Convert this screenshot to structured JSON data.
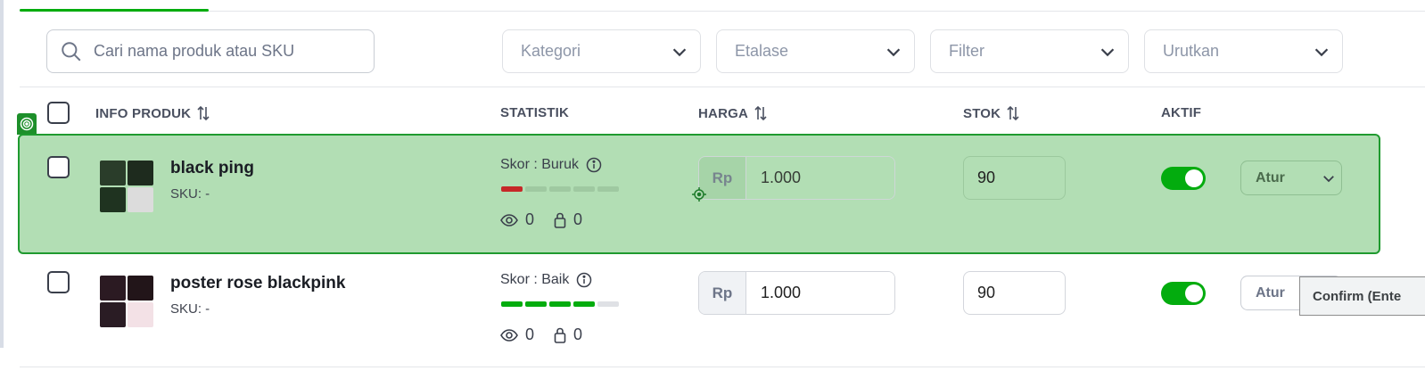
{
  "search": {
    "placeholder": "Cari nama produk atau SKU"
  },
  "filters": [
    {
      "label": "Kategori"
    },
    {
      "label": "Etalase"
    },
    {
      "label": "Filter"
    },
    {
      "label": "Urutkan"
    }
  ],
  "table": {
    "headers": {
      "info": "INFO PRODUK",
      "statistik": "STATISTIK",
      "harga": "HARGA",
      "stok": "STOK",
      "aktif": "AKTIF"
    },
    "rows": [
      {
        "name": "black ping",
        "sku": "SKU: -",
        "skor_label": "Skor : Buruk",
        "score_level": 1,
        "score_color": "#c62828",
        "views": "0",
        "sold": "0",
        "currency": "Rp",
        "price": "1.000",
        "stock": "90",
        "active": true,
        "action": "Atur"
      },
      {
        "name": "poster rose blackpink",
        "sku": "SKU: -",
        "skor_label": "Skor : Baik",
        "score_level": 4,
        "score_color": "#03ac0e",
        "views": "0",
        "sold": "0",
        "currency": "Rp",
        "price": "1.000",
        "stock": "90",
        "active": true,
        "action": "Atur"
      }
    ]
  },
  "tooltip": {
    "text": "Confirm (Ente"
  },
  "colors": {
    "accent": "#03ac0e",
    "highlight": "#b2deb4",
    "highlight_border": "#1f9a2f"
  }
}
